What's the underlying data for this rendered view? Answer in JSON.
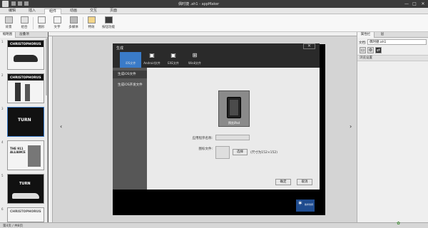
{
  "window": {
    "title": "偶时捷 .ah1 - appMaker",
    "controls": [
      "—",
      "□",
      "✕"
    ]
  },
  "menu": {
    "tabs": [
      "编辑",
      "插入",
      "组件",
      "动画",
      "交互",
      "页面"
    ],
    "active": "组件"
  },
  "ribbon": {
    "buttons": [
      "背景",
      "组合",
      "图形",
      "文字",
      "多媒体",
      "特效",
      "按钮功能"
    ]
  },
  "left_panel": {
    "tabs": [
      "缩略图",
      "层叠项"
    ],
    "slides": [
      {
        "number": "1",
        "caption": "CHRISTOPHORUS"
      },
      {
        "number": "2",
        "caption": "CHRISTOPHORUS"
      },
      {
        "number": "3",
        "caption": "TURN"
      },
      {
        "number": "4",
        "caption": "THE 911 ALLIANCE"
      },
      {
        "number": "5",
        "caption": "TURN"
      },
      {
        "number": "6",
        "caption": "CHRISTOPHORUS"
      }
    ]
  },
  "dialog": {
    "title": "生成",
    "close": "✕",
    "platforms": [
      {
        "icon": "apple-icon",
        "glyph": "",
        "label": "iOS文件"
      },
      {
        "icon": "android-icon",
        "glyph": "🤖",
        "label": "Android文件"
      },
      {
        "icon": "exe-icon",
        "glyph": "▣",
        "label": "EXE文件"
      },
      {
        "icon": "windows-icon",
        "glyph": "⊞",
        "label": "Win8文件"
      }
    ],
    "side_items": [
      "生成iOS文件",
      "生成iOS开发文件"
    ],
    "preview_caption": "预览iPad",
    "app_name_label": "应用程序名称:",
    "app_name_value": "",
    "icon_file_label": "图标文件:",
    "browse_button": "选择",
    "size_hint": "(尺寸为152×152)",
    "ok_button": "确定",
    "cancel_button": "取消"
  },
  "right_panel": {
    "tabs": [
      "属性栏",
      "层"
    ],
    "doc_label": "文档:",
    "doc_value": "偶时捷.ah1",
    "section": "浏览设置"
  },
  "status": {
    "text": "第4页 / 共8页"
  },
  "nav": {
    "left_arrow": "‹",
    "right_arrow": "›"
  },
  "brand": {
    "logo_text": "技术支持"
  },
  "colors": {
    "accent": "#3a7bc8",
    "dialog_header": "#2a2a2a"
  }
}
